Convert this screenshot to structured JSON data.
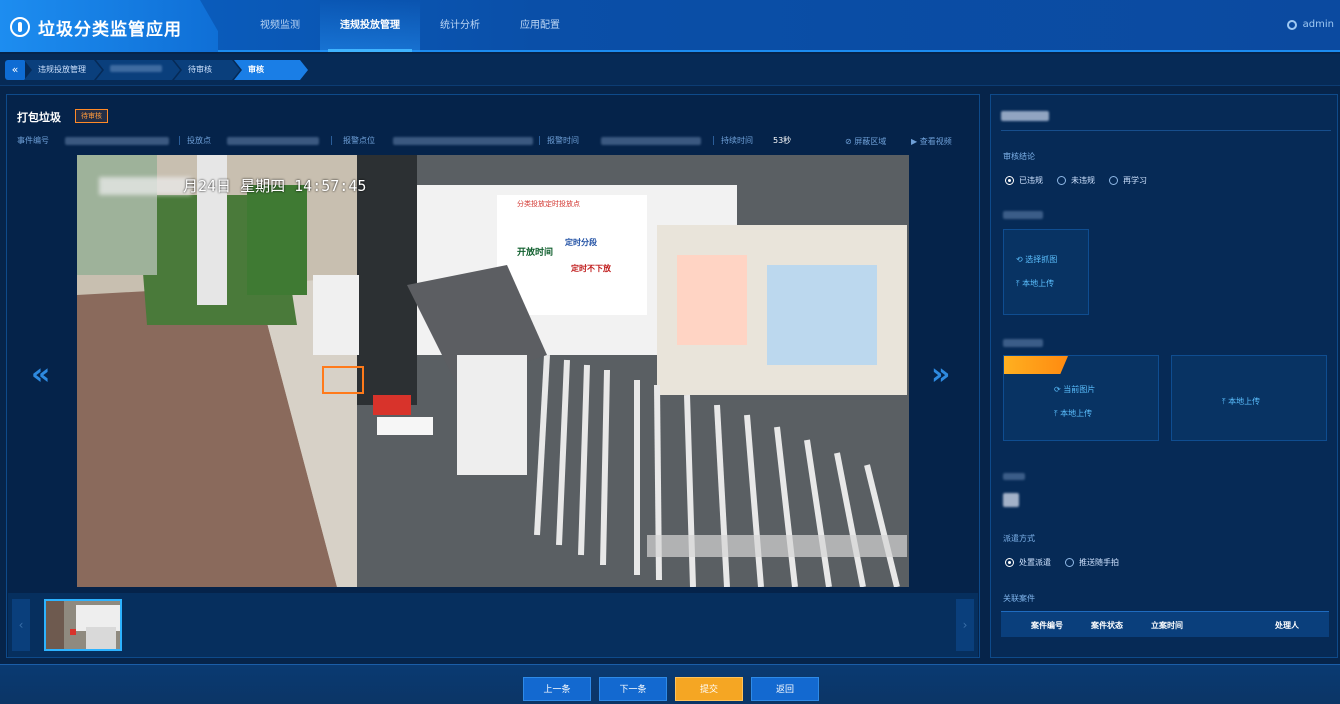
{
  "app": {
    "title": "垃圾分类监管应用"
  },
  "nav": {
    "items": [
      "视频监测",
      "违规投放管理",
      "统计分析",
      "应用配置"
    ]
  },
  "user": {
    "name": "admin"
  },
  "breadcrumb": {
    "items": [
      "违规投放管理",
      "待审核",
      "审核"
    ]
  },
  "event": {
    "title": "打包垃圾",
    "status": "待审核",
    "meta": {
      "event_no_label": "事件编号",
      "drop_point_label": "投放点",
      "alarm_point_label": "报警点位",
      "alarm_time_label": "报警时间",
      "duration_label": "持续时间",
      "duration_value": "53秒"
    },
    "tools": {
      "mask_region": "屏蔽区域",
      "view_video": "查看视频"
    },
    "overlay": {
      "date": "月24日",
      "weekday": "星期四",
      "time": "14:57:45"
    },
    "board": {
      "title": "分类投放定时投放点",
      "schedule_title": "开放时间",
      "slogan1": "定时分段",
      "slogan2": "定时不下放"
    }
  },
  "review": {
    "conclusion_label": "审核结论",
    "options": [
      "已违规",
      "未违规",
      "再学习"
    ],
    "selected_option": "已违规",
    "capture": {
      "select": "选择抓图",
      "local_upload": "本地上传"
    },
    "current_image": "当前图片",
    "local_upload": "本地上传",
    "dispatch_label": "派遣方式",
    "dispatch_options": [
      "处置派遣",
      "推送随手拍"
    ],
    "dispatch_selected": "处置派遣",
    "related_label": "关联案件",
    "table_headers": [
      "案件编号",
      "案件状态",
      "立案时间",
      "处理人"
    ]
  },
  "footer": {
    "prev": "上一条",
    "next": "下一条",
    "submit": "提交",
    "back": "返回"
  },
  "colors": {
    "accent": "#1a7ee6",
    "warning": "#ff8a28",
    "submit": "#f5a623"
  }
}
